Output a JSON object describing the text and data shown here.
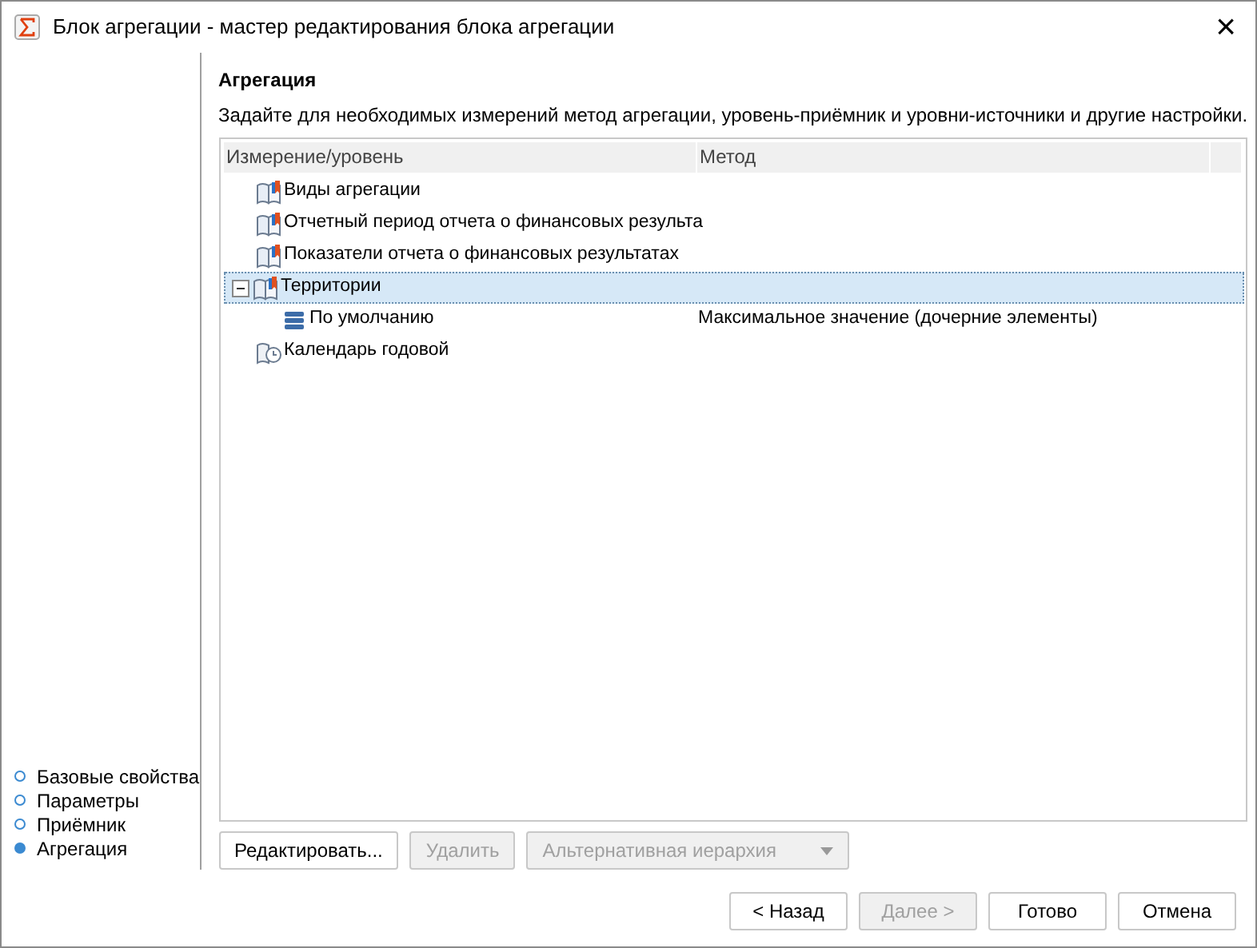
{
  "window": {
    "title": "Блок агрегации - мастер редактирования блока агрегации",
    "close": "×"
  },
  "steps": [
    {
      "label": "Базовые свойства",
      "selected": false
    },
    {
      "label": "Параметры",
      "selected": false
    },
    {
      "label": "Приёмник",
      "selected": false
    },
    {
      "label": "Агрегация",
      "selected": true
    }
  ],
  "heading": "Агрегация",
  "description": "Задайте для необходимых измерений метод агрегации, уровень-приёмник и уровни-источники и другие настройки.",
  "tree": {
    "columns": [
      "Измерение/уровень",
      "Метод"
    ],
    "rows": [
      {
        "kind": "dimension",
        "label": "Виды агрегации",
        "selected": false
      },
      {
        "kind": "dimension",
        "label": "Отчетный период отчета о финансовых результа",
        "selected": false
      },
      {
        "kind": "dimension",
        "label": "Показатели отчета о финансовых результатах",
        "selected": false
      },
      {
        "kind": "dimension",
        "label": "Территории",
        "selected": true,
        "expanded": true,
        "children": [
          {
            "kind": "level",
            "label": "По умолчанию",
            "method": "Максимальное значение (дочерние элементы)",
            "selected": false
          }
        ]
      },
      {
        "kind": "calendar",
        "label": "Календарь годовой",
        "selected": false
      }
    ]
  },
  "actions": [
    {
      "label": "Редактировать...",
      "disabled": false
    },
    {
      "label": "Удалить",
      "disabled": true
    },
    {
      "label": "Альтернативная иерархия",
      "disabled": true,
      "kind": "dropdown"
    }
  ],
  "buttons": [
    {
      "label": "< Назад",
      "disabled": false
    },
    {
      "label": "Далее >",
      "disabled": true
    },
    {
      "label": "Готово",
      "disabled": false
    },
    {
      "label": "Отмена",
      "disabled": false
    }
  ]
}
